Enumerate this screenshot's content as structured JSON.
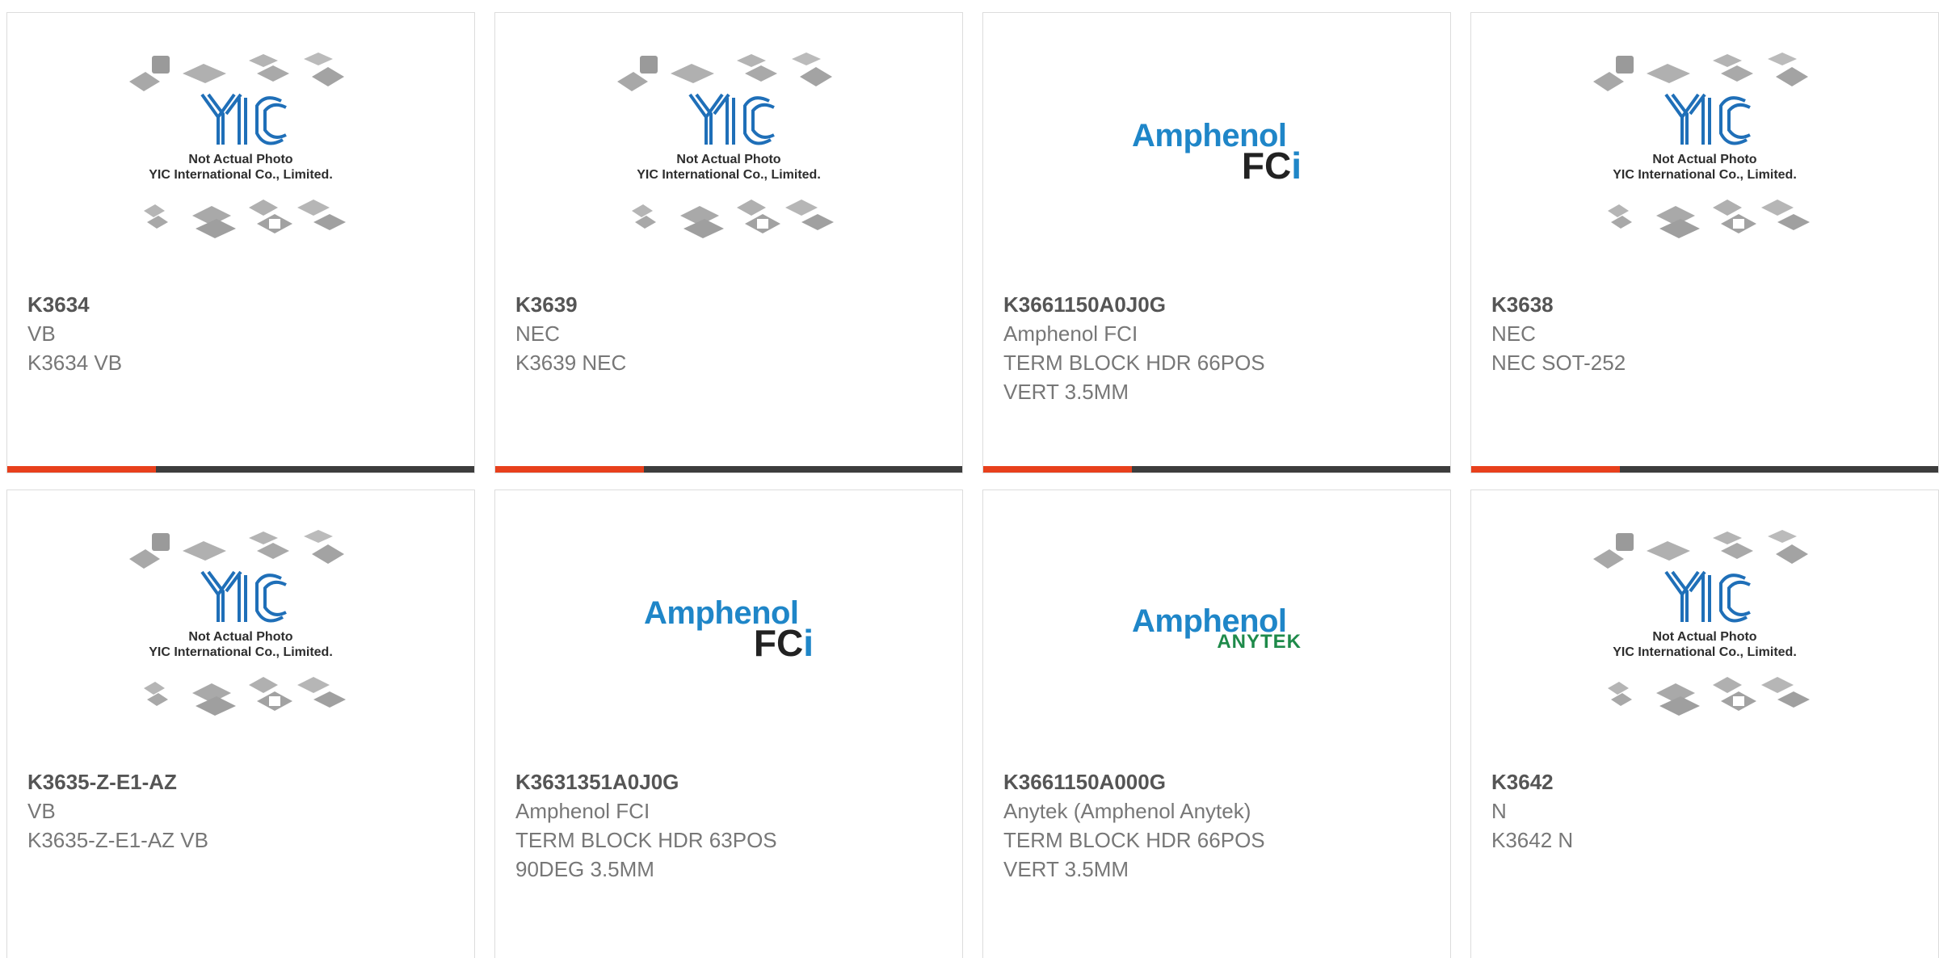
{
  "placeholder": {
    "line1": "Not Actual Photo",
    "line2": "YIC International Co., Limited."
  },
  "logos": {
    "amphenol": "Amphenol",
    "fci": "FC",
    "fci_i": "i",
    "anytek": "ANYTEK"
  },
  "colors": {
    "accent": "#e8401c",
    "bar": "#3d3d3d",
    "amphenol_blue": "#1f86c8",
    "anytek_green": "#1e8a4a"
  },
  "products": [
    {
      "part_number": "K3634",
      "manufacturer": "VB",
      "description": [
        "K3634 VB"
      ],
      "image": "placeholder"
    },
    {
      "part_number": "K3639",
      "manufacturer": "NEC",
      "description": [
        "K3639 NEC"
      ],
      "image": "placeholder"
    },
    {
      "part_number": "K3661150A0J0G",
      "manufacturer": "Amphenol FCI",
      "description": [
        "TERM BLOCK HDR 66POS",
        "VERT 3.5MM"
      ],
      "image": "amphenol-fci-logo"
    },
    {
      "part_number": "K3638",
      "manufacturer": "NEC",
      "description": [
        "NEC SOT-252"
      ],
      "image": "placeholder"
    },
    {
      "part_number": "K3635-Z-E1-AZ",
      "manufacturer": "VB",
      "description": [
        "K3635-Z-E1-AZ VB"
      ],
      "image": "placeholder"
    },
    {
      "part_number": "K3631351A0J0G",
      "manufacturer": "Amphenol FCI",
      "description": [
        "TERM BLOCK HDR 63POS",
        "90DEG 3.5MM"
      ],
      "image": "amphenol-fci-logo"
    },
    {
      "part_number": "K3661150A000G",
      "manufacturer": "Anytek (Amphenol Anytek)",
      "description": [
        "TERM BLOCK HDR 66POS",
        "VERT 3.5MM"
      ],
      "image": "amphenol-anytek-logo"
    },
    {
      "part_number": "K3642",
      "manufacturer": "N",
      "description": [
        "K3642 N"
      ],
      "image": "placeholder"
    }
  ]
}
